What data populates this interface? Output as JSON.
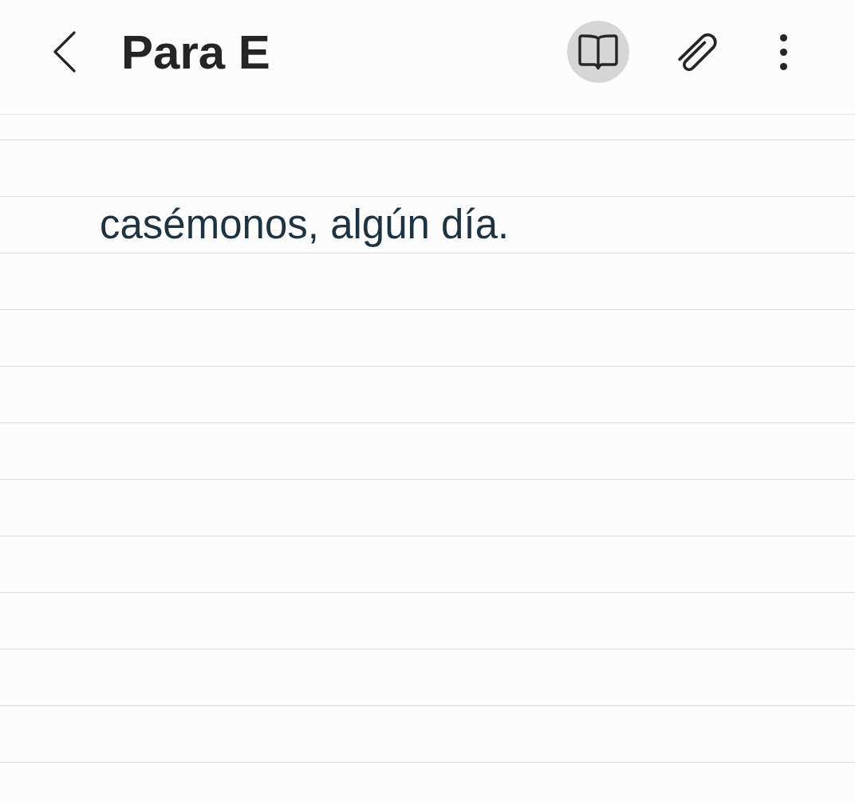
{
  "header": {
    "title": "Para E",
    "actions": [
      {
        "kind": "reading-mode",
        "on": true
      },
      {
        "kind": "attach",
        "on": false
      },
      {
        "kind": "more",
        "on": false
      }
    ]
  },
  "note": {
    "lines": [
      "casémonos, algún día."
    ]
  }
}
